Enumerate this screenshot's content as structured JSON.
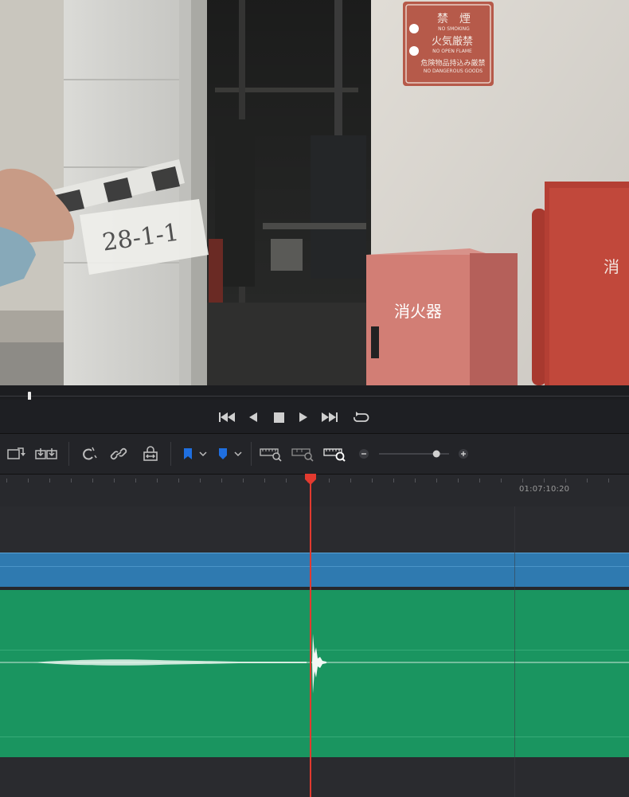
{
  "viewer": {
    "sign": {
      "line1": "禁　煙",
      "line1_en": "NO SMOKING",
      "line2": "火気厳禁",
      "line2_en": "NO OPEN FLAME",
      "line3": "危険物品持込み厳禁",
      "line3_en": "NO DANGEROUS GOODS"
    },
    "box_label": "消火器",
    "cabinet_label": "消",
    "slate_text": "28-1-1"
  },
  "transport": {
    "buttons": [
      "skip-to-start",
      "play-reverse",
      "stop",
      "play",
      "skip-to-end",
      "loop"
    ]
  },
  "toolbar": {
    "zoom_value": 0.82,
    "icons": [
      "overwrite-icon",
      "ripple-icon",
      "snapping-icon",
      "link-icon",
      "position-lock-icon",
      "flag-icon",
      "marker-icon",
      "zoom-full-icon",
      "zoom-detail-icon",
      "zoom-custom-icon",
      "zoom-out-icon",
      "zoom-in-icon"
    ]
  },
  "ruler": {
    "timecode": "01:07:10:20"
  },
  "colors": {
    "video_clip": "#2f7ab0",
    "audio_clip": "#1a9560",
    "playhead": "#e23a2f",
    "flag_blue": "#1f6fe0"
  }
}
